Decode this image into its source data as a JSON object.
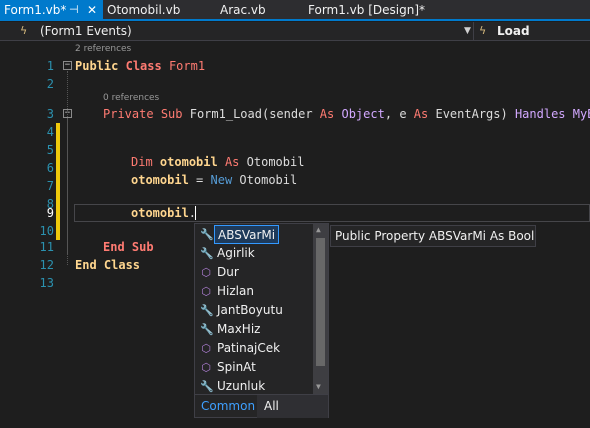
{
  "tabs": [
    {
      "label": "Form1.vb*",
      "pin": "⊣",
      "close": "✕"
    },
    {
      "label": "Otomobil.vb"
    },
    {
      "label": "Arac.vb"
    },
    {
      "label": "Form1.vb [Design]*"
    }
  ],
  "navbar": {
    "left": "(Form1 Events)",
    "right": "Load"
  },
  "editor": {
    "line_numbers": [
      "1",
      "2",
      "3",
      "4",
      "5",
      "6",
      "7",
      "8",
      "9",
      "10",
      "11",
      "12",
      "13"
    ],
    "codelens": [
      "2 references",
      "0 references"
    ],
    "line1": {
      "kw1": "Public",
      "kw2": "Class",
      "name": "Form1"
    },
    "line3": {
      "kw1": "Private",
      "kw2": "Sub",
      "name": "Form1_Load",
      "p1": "(sender",
      "as1": "As",
      "t1": "Object",
      "comma": ",",
      "p2": "e",
      "as2": "As",
      "t2": "EventArgs)",
      "handles": "Handles",
      "rest": "MyBa"
    },
    "line7": {
      "kw": "Dim",
      "var": "otomobil",
      "as": "As",
      "type": "Otomobil"
    },
    "line8": {
      "var": "otomobil",
      "eq": "=",
      "kw": "New",
      "type": "Otomobil"
    },
    "line9": {
      "var": "otomobil",
      "dot": "."
    },
    "line11": {
      "text": "End Sub"
    },
    "line12": {
      "text": "End Class"
    }
  },
  "completion": {
    "items": [
      {
        "label": "ABSVarMi",
        "icon": "wrench-icon",
        "glyph": "🔧"
      },
      {
        "label": "Agirlik",
        "icon": "wrench-icon",
        "glyph": "🔧"
      },
      {
        "label": "Dur",
        "icon": "method-cube-icon",
        "glyph": "⬡"
      },
      {
        "label": "Hizlan",
        "icon": "method-cube-icon",
        "glyph": "⬡"
      },
      {
        "label": "JantBoyutu",
        "icon": "wrench-icon",
        "glyph": "🔧"
      },
      {
        "label": "MaxHiz",
        "icon": "wrench-icon",
        "glyph": "🔧"
      },
      {
        "label": "PatinajCek",
        "icon": "method-cube-icon",
        "glyph": "⬡"
      },
      {
        "label": "SpinAt",
        "icon": "method-cube-icon",
        "glyph": "⬡"
      },
      {
        "label": "Uzunluk",
        "icon": "wrench-icon",
        "glyph": "🔧"
      }
    ],
    "filters": {
      "common": "Common",
      "all": "All"
    },
    "tooltip": "Public Property ABSVarMi As Boolean"
  },
  "colors": {
    "accent": "#007acc",
    "modified_bar": "#efc90c",
    "background": "#1e1e1e"
  }
}
